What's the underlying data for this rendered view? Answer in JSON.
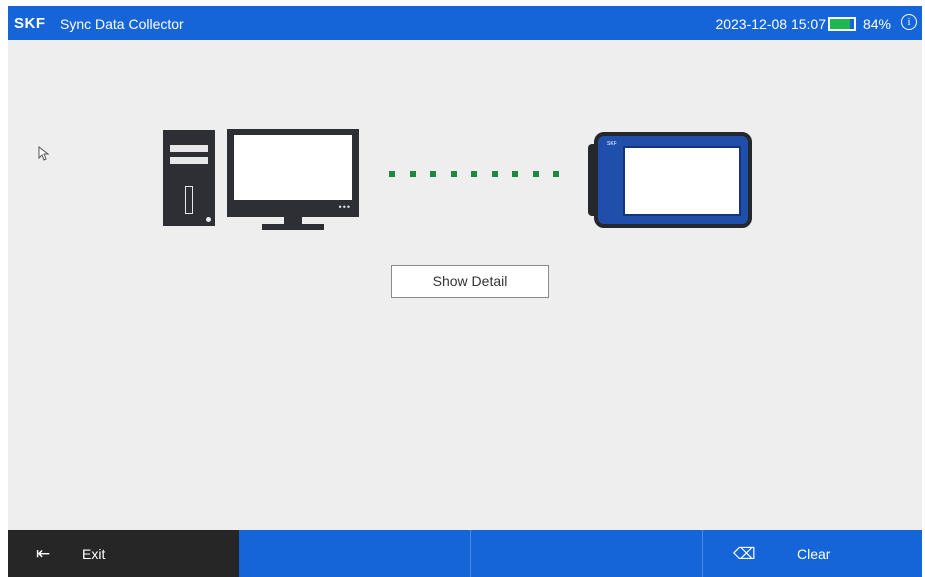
{
  "header": {
    "logo": "SKF",
    "title": "Sync Data Collector",
    "datetime": "2023-12-08 15:07",
    "battery_percent": "84%",
    "battery_level": 0.84,
    "info_icon": "i"
  },
  "main": {
    "show_detail_label": "Show Detail"
  },
  "footer": {
    "exit_label": "Exit",
    "clear_label": "Clear",
    "exit_icon": "logout-icon",
    "clear_icon": "eraser-icon"
  },
  "colors": {
    "header_bg": "#1565d8",
    "footer_bg": "#1565d8",
    "exit_bg": "#262626",
    "battery_fill": "#1fb84e",
    "connection_dots": "#1b8a3f"
  }
}
